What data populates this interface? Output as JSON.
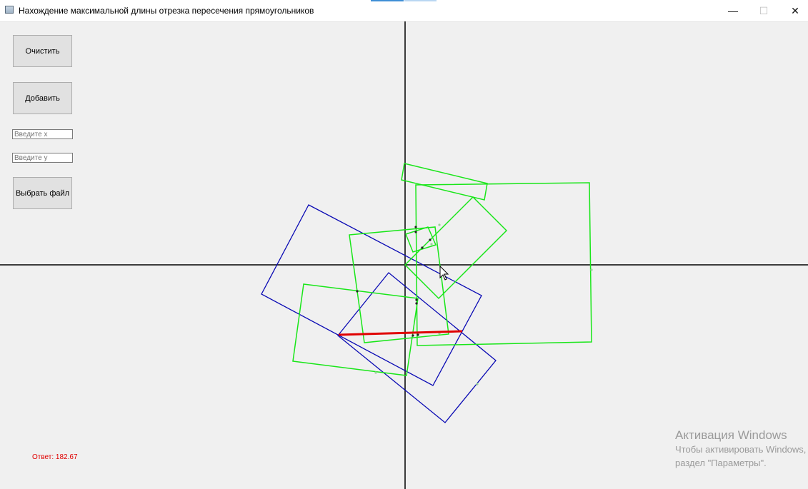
{
  "window": {
    "title": "Нахождение максимальной длины отрезка пересечения прямоугольников",
    "controls": {
      "minimize": "—",
      "maximize": "☐",
      "close": "✕"
    }
  },
  "controls": {
    "clear_label": "Очистить",
    "add_label": "Добавить",
    "x_placeholder": "Введите x",
    "y_placeholder": "Введите y",
    "choose_file_label": "Выбрать файл"
  },
  "answer_text": "Ответ: 182.67",
  "activation_notice": {
    "heading": "Активация Windows",
    "line1": "Чтобы активировать Windows, перейдите в",
    "line2": "раздел \"Параметры\"."
  },
  "colors": {
    "green_rect": "#19e619",
    "blue_rect": "#0a0ab4",
    "segment": "#e00000",
    "axes": "#000000",
    "answer": "#e00000"
  },
  "icons": {
    "app": "app-window-icon",
    "minimize": "minimize-icon",
    "maximize": "maximize-icon",
    "close": "close-icon",
    "cursor": "mouse-pointer-icon"
  }
}
